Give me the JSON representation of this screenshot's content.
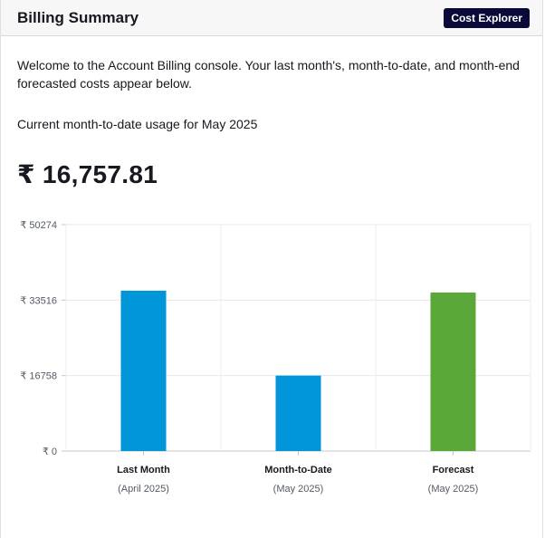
{
  "header": {
    "title": "Billing Summary",
    "cost_explorer_label": "Cost Explorer"
  },
  "intro": "Welcome to the Account Billing console. Your last month's, month-to-date, and month-end forecasted costs appear below.",
  "current_label": "Current month-to-date usage for May 2025",
  "current_amount": "₹ 16,757.81",
  "colors": {
    "actual": "#0096d9",
    "forecast": "#5ba83a",
    "header_bg": "#f7f7f7",
    "button_bg": "#0a0a3a"
  },
  "chart_data": {
    "type": "bar",
    "categories": [
      "Last Month",
      "Month-to-Date",
      "Forecast"
    ],
    "sublabels": [
      "(April 2025)",
      "(May 2025)",
      "(May 2025)"
    ],
    "values": [
      35600,
      16757.81,
      35200
    ],
    "bar_colors": [
      "#0096d9",
      "#0096d9",
      "#5ba83a"
    ],
    "yticks": [
      0,
      16758,
      33516,
      50274
    ],
    "ytick_labels": [
      "₹ 0",
      "₹ 16758",
      "₹ 33516",
      "₹ 50274"
    ],
    "ylim": [
      0,
      50274
    ],
    "grid": true
  }
}
